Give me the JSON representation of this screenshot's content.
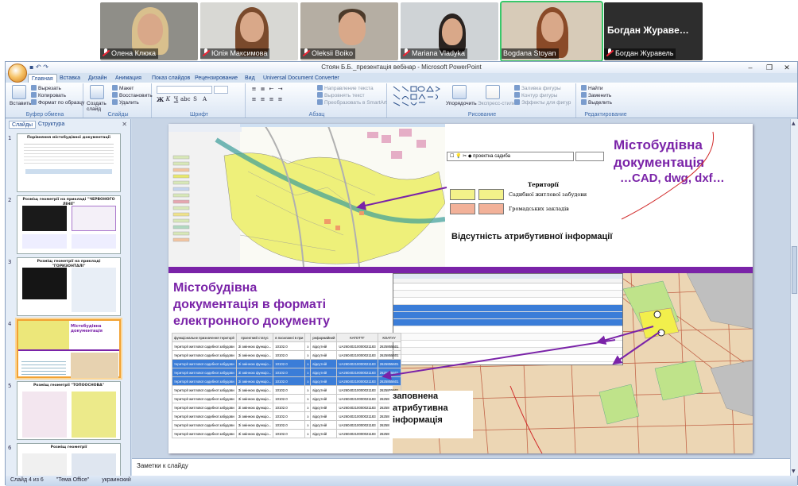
{
  "participants": [
    {
      "name": "Олена Клюка"
    },
    {
      "name": "Юлія Максимова"
    },
    {
      "name": "Oleksii Boiko"
    },
    {
      "name": "Mariana Vladyka"
    },
    {
      "name": "Bogdana Stoyan"
    },
    {
      "name": "Богдан Журавель",
      "header": "Богдан Журавe…"
    }
  ],
  "window": {
    "title": "Стоян Б.Б._презентація вебінар - Microsoft PowerPoint",
    "controls": [
      "–",
      "❐",
      "✕"
    ]
  },
  "ribbon": {
    "tabs": [
      "Главная",
      "Вставка",
      "Дизайн",
      "Анимация",
      "Показ слайдов",
      "Рецензирование",
      "Вид",
      "Universal Document Converter"
    ],
    "active_tab": "Главная",
    "clipboard": {
      "paste": "Вставить",
      "cut": "Вырезать",
      "copy": "Копировать",
      "format_painter": "Формат по образцу",
      "label": "Буфер обмена"
    },
    "slides": {
      "new_slide": "Создать слайд",
      "layout": "Макет",
      "reset": "Восстановить",
      "delete": "Удалить",
      "label": "Слайды"
    },
    "font": {
      "label": "Шрифт"
    },
    "paragraph": {
      "text_direction": "Направление текста",
      "align_text": "Выровнять текст",
      "smartart": "Преобразовать в SmartArt",
      "label": "Абзац"
    },
    "drawing": {
      "arrange": "Упорядочить",
      "quick_styles": "Экспресс-стили",
      "fill": "Заливка фигуры",
      "outline": "Контур фигуры",
      "effects": "Эффекты для фигур",
      "label": "Рисование"
    },
    "editing": {
      "find": "Найти",
      "replace": "Заменить",
      "select": "Выделить",
      "label": "Редактирование"
    }
  },
  "left_pane": {
    "tabs": [
      "Слайды",
      "Структура"
    ],
    "thumbnails": [
      {
        "num": "1",
        "title": "Порівняння містобудівної документації"
      },
      {
        "num": "2",
        "title": "Розміщ геометрії на прикладі \"ЧЕРВОНОГО ЛІНІЇ\""
      },
      {
        "num": "3",
        "title": "Розміщ геометрії на прикладі \"ГОРИЗОНТАЛІ\""
      },
      {
        "num": "4",
        "title": "Містобудівна документація"
      },
      {
        "num": "5",
        "title": "Розміщ геометрії \"ТОПООСНОВА\""
      },
      {
        "num": "6",
        "title": "Розміщ геометрії"
      }
    ],
    "selected_index": 3
  },
  "slide": {
    "heading_top": "Містобудівна документація",
    "formats": "…CAD, dwg, dxf…",
    "no_attributes": "Відсутність  атрибутивної інформації",
    "heading_bottom_lines": [
      "Містобудівна",
      "документація  в  форматі",
      "електронного документу"
    ],
    "filled_attributes_lines": [
      "заповнена",
      "атрибутивна",
      "інформація"
    ],
    "layer_name": "проектна садиба",
    "legend": {
      "title": "Території",
      "items": [
        "Садибної житлової забудови",
        "Громадських закладів"
      ]
    },
    "table_headers": [
      "функціональне призначення території",
      "проектний статус",
      "в посиланні в при",
      "реформайний",
      "КАТОТТГ",
      "КОАТУУ"
    ],
    "table_rows": [
      [
        "території житлової садибної забудови",
        "Зі змінною функціо...",
        "10102.0",
        "з ",
        "відсутній",
        "UA26040210000021183",
        "2625855601"
      ],
      [
        "території житлової садибної забудови",
        "Зі змінною функціо...",
        "10102.0",
        "з ",
        "відсутній",
        "UA26040210000021183",
        "2625855601"
      ],
      [
        "території житлової садибної забудови",
        "Зі змінною функціо...",
        "10102.0",
        "з ",
        "відсутній",
        "UA26040210000021183",
        "2625855601"
      ],
      [
        "території житлової садибної забудови",
        "Зі змінною функціо...",
        "10102.0",
        "з ",
        "відсутній",
        "UA26040210000021183",
        "2625855601"
      ],
      [
        "території житлової садибної забудови",
        "Зі змінною функціо...",
        "10102.0",
        "з ",
        "відсутній",
        "UA26040210000021183",
        "2625855601"
      ],
      [
        "території житлової садибної забудови",
        "Зі змінною функціо...",
        "10102.0",
        "з ",
        "відсутній",
        "UA26040210000021183",
        "2625855601"
      ],
      [
        "території житлової садибної забудови",
        "Зі змінною функціо...",
        "10102.0",
        "з ",
        "відсутній",
        "UA26040210000021183",
        "2625855601"
      ],
      [
        "території житлової садибної забудови",
        "Зі змінною функціо...",
        "10102.0",
        "з ",
        "відсутній",
        "UA26040210000021183",
        "2625855601"
      ],
      [
        "території житлової садибної забудови",
        "Зі змінною функціо...",
        "10102.0",
        "з ",
        "відсутній",
        "UA26040210000021183",
        "2625855601"
      ],
      [
        "території житлової садибної забудови",
        "Зі змінною функціо...",
        "10102.0",
        "з ",
        "відсутній",
        "UA26040210000021183",
        "2625855601"
      ],
      [
        "території житлової садибної забудови",
        "Зі змінною функціо...",
        "10102.0",
        "з ",
        "відсутній",
        "UA26040210000021183",
        "2625855601"
      ]
    ],
    "selected_rows": [
      2,
      3,
      4
    ]
  },
  "notes": {
    "placeholder": "Заметки к слайду"
  },
  "status": {
    "slide_info": "Слайд 4 из 6",
    "theme": "\"Тема Office\"",
    "language": "украинский"
  },
  "colors": {
    "accent_purple": "#7a23a8",
    "selection_blue": "#3b7dd8",
    "map_yellow": "#eef07a"
  }
}
